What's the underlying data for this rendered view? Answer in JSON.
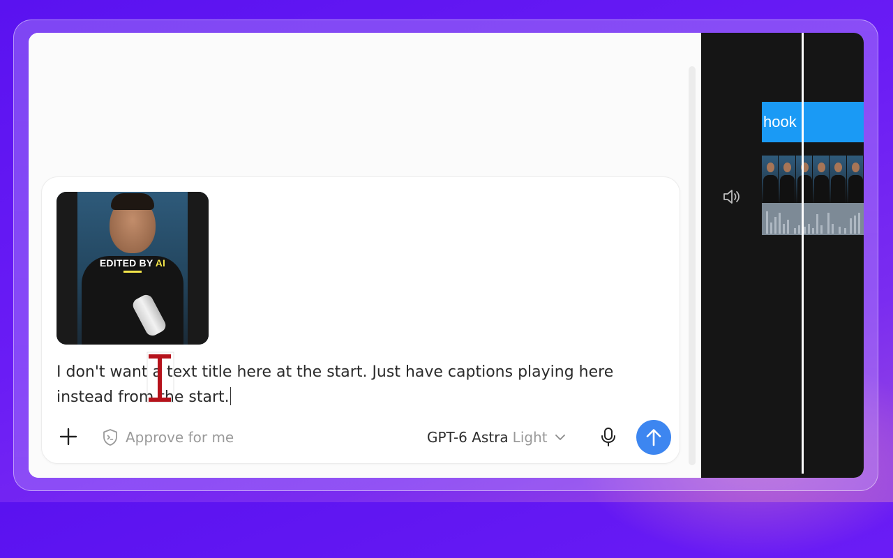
{
  "thumbnail": {
    "caption_prefix": "EDITED BY",
    "caption_highlight": "AI"
  },
  "composer": {
    "text": "I don't want a text title here at the start. Just have captions playing here instead from the start."
  },
  "toolbar": {
    "approve_label": "Approve for me",
    "model_name": "GPT-6 Astra",
    "model_variant": "Light"
  },
  "timeline": {
    "clip_label": "hook"
  },
  "icons": {
    "add": "plus-icon",
    "approve": "shield-code-icon",
    "dropdown": "chevron-down-icon",
    "mic": "microphone-icon",
    "send": "arrow-up-icon",
    "volume": "speaker-icon"
  },
  "colors": {
    "send_button": "#3d86f0",
    "clip": "#1a9af5",
    "cursor": "#b5121b",
    "caption_highlight": "#f4e64a"
  }
}
